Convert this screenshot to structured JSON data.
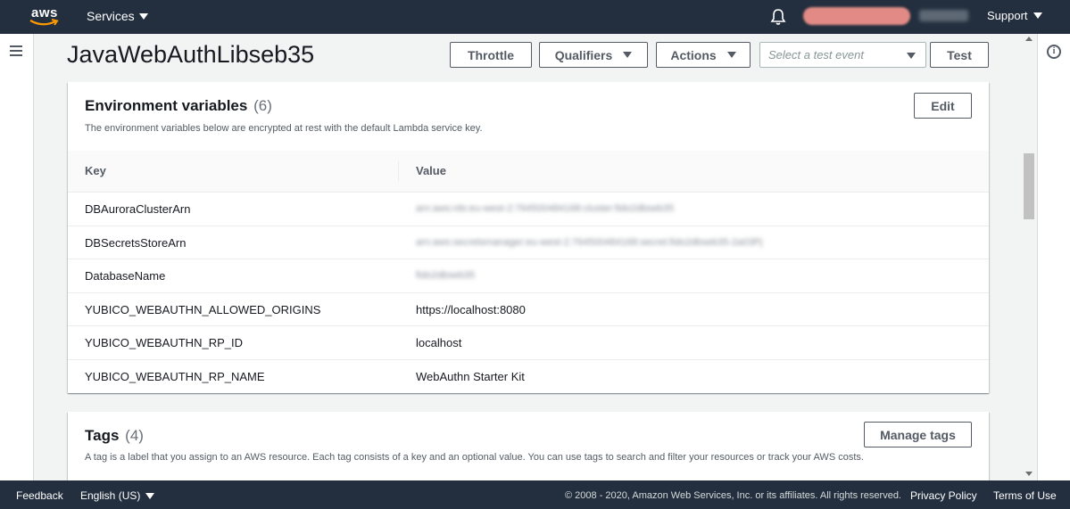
{
  "topnav": {
    "logo_text": "aws",
    "services_label": "Services",
    "support_label": "Support"
  },
  "header": {
    "function_name": "JavaWebAuthLibseb35",
    "throttle_label": "Throttle",
    "qualifiers_label": "Qualifiers",
    "actions_label": "Actions",
    "test_event_placeholder": "Select a test event",
    "test_label": "Test"
  },
  "env_panel": {
    "title": "Environment variables",
    "count": "(6)",
    "edit_label": "Edit",
    "description": "The environment variables below are encrypted at rest with the default Lambda service key.",
    "columns": {
      "key": "Key",
      "value": "Value"
    },
    "rows": [
      {
        "key": "DBAuroraClusterArn",
        "value": "arn:aws:rds:eu-west-2:764500484168:cluster:fido2dbseb35"
      },
      {
        "key": "DBSecretsStoreArn",
        "value": "arn:aws:secretsmanager:eu-west-2:764500484168:secret:fido2dbseb35-2a03Pj"
      },
      {
        "key": "DatabaseName",
        "value": "fido2dbseb35"
      },
      {
        "key": "YUBICO_WEBAUTHN_ALLOWED_ORIGINS",
        "value": "https://localhost:8080"
      },
      {
        "key": "YUBICO_WEBAUTHN_RP_ID",
        "value": "localhost"
      },
      {
        "key": "YUBICO_WEBAUTHN_RP_NAME",
        "value": "WebAuthn Starter Kit"
      }
    ]
  },
  "tags_panel": {
    "title": "Tags",
    "count": "(4)",
    "manage_label": "Manage tags",
    "description": "A tag is a label that you assign to an AWS resource. Each tag consists of a key and an optional value. You can use tags to search and filter your resources or track your AWS costs."
  },
  "footer": {
    "feedback": "Feedback",
    "language": "English (US)",
    "copyright": "© 2008 - 2020, Amazon Web Services, Inc. or its affiliates. All rights reserved.",
    "privacy": "Privacy Policy",
    "terms": "Terms of Use"
  },
  "colors": {
    "nav_bg": "#232f3e",
    "page_bg": "#f2f3f3",
    "button_border": "#545b64"
  }
}
